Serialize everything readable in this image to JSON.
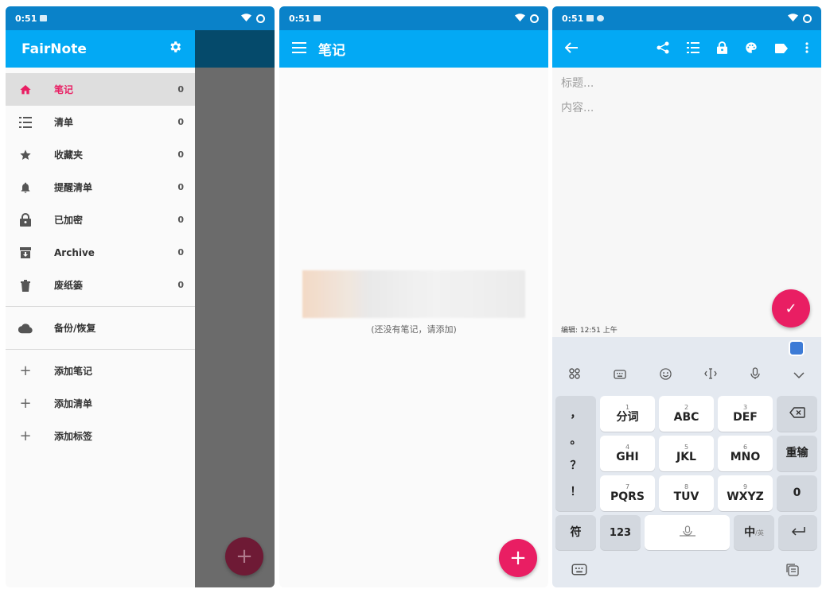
{
  "status": {
    "s1_time": "0:51",
    "s2_time": "0:51",
    "s3_time": "0:51"
  },
  "s1": {
    "app_title": "FairNote",
    "items": [
      {
        "label": "笔记",
        "count": "0"
      },
      {
        "label": "清单",
        "count": "0"
      },
      {
        "label": "收藏夹",
        "count": "0"
      },
      {
        "label": "提醒清单",
        "count": "0"
      },
      {
        "label": "已加密",
        "count": "0"
      },
      {
        "label": "Archive",
        "count": "0"
      },
      {
        "label": "废纸篓",
        "count": "0"
      }
    ],
    "backup_label": "备份/恢复",
    "actions": [
      {
        "label": "添加笔记"
      },
      {
        "label": "添加清单"
      },
      {
        "label": "添加标签"
      }
    ],
    "fab": "+"
  },
  "s2": {
    "title": "笔记",
    "empty_text": "(还没有笔记，请添加)",
    "fab": "+"
  },
  "s3": {
    "title_placeholder": "标题...",
    "content_placeholder": "内容...",
    "edited": "编辑: 12:51 上午",
    "fab": "✓",
    "keys": {
      "punct1": "，",
      "punct2": "。",
      "punct3": "？",
      "punct4": "！",
      "k1_num": "1",
      "k1": "分词",
      "k2_num": "2",
      "k2": "ABC",
      "k3_num": "3",
      "k3": "DEF",
      "k4_num": "4",
      "k4": "GHI",
      "k5_num": "5",
      "k5": "JKL",
      "k6_num": "6",
      "k6": "MNO",
      "k7_num": "7",
      "k7": "PQRS",
      "k8_num": "8",
      "k8": "TUV",
      "k9_num": "9",
      "k9": "WXYZ",
      "reenter": "重输",
      "zero": "0",
      "symbol": "符",
      "num": "123",
      "zh": "中",
      "zh_sub": "/英"
    }
  }
}
